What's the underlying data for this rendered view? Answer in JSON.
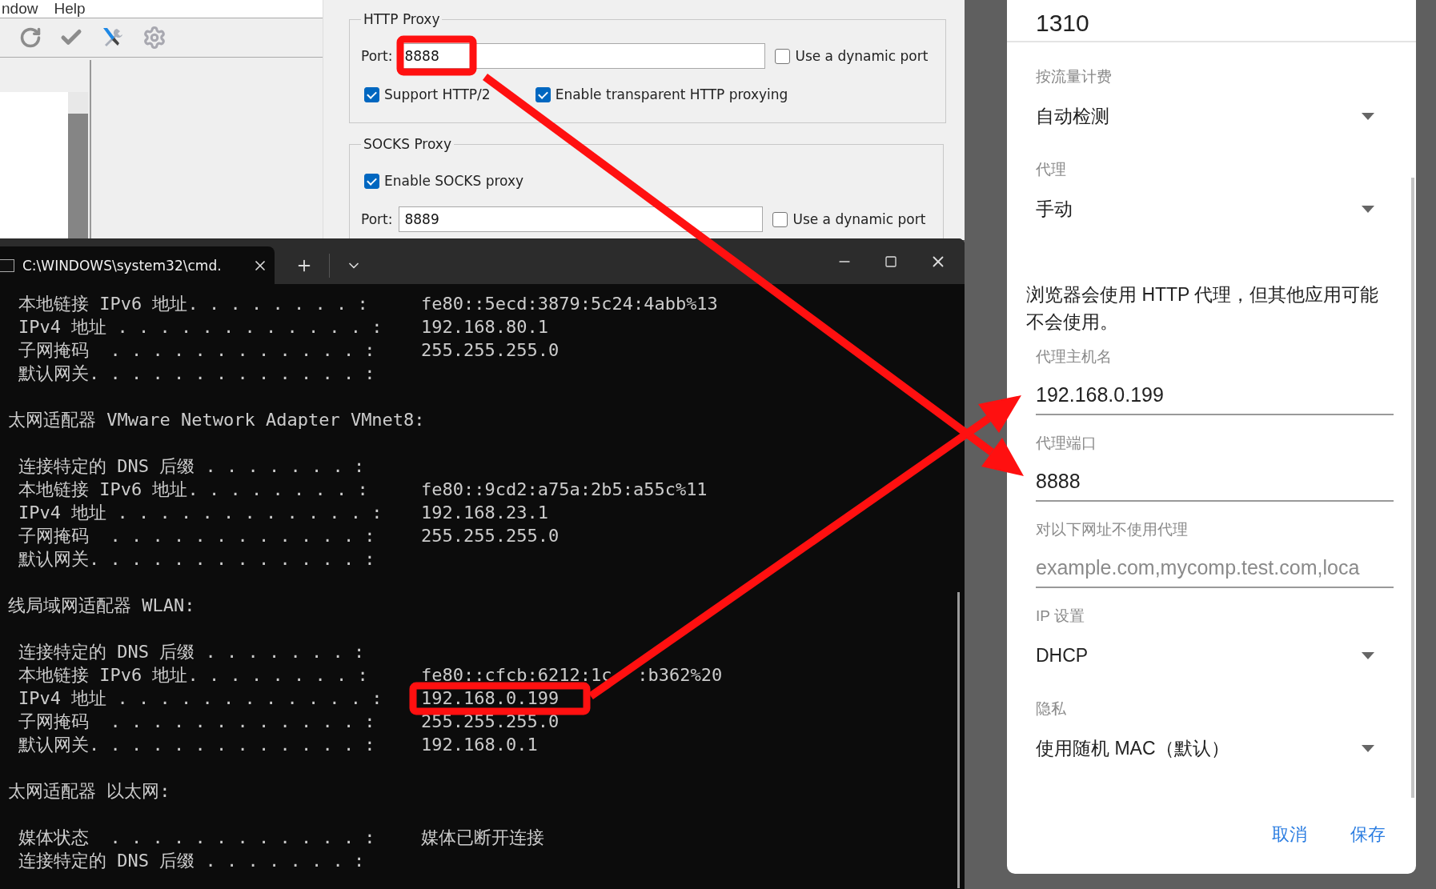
{
  "charles_window": {
    "menu": [
      "ndow",
      "Help"
    ]
  },
  "proxy_settings": {
    "http_proxy": {
      "title": "HTTP Proxy",
      "port_label": "Port:",
      "port": "8888",
      "dynamic_port": {
        "label": "Use a dynamic port",
        "checked": false
      },
      "options": [
        {
          "label": "Support HTTP/2",
          "checked": true
        },
        {
          "label": "Enable transparent HTTP proxying",
          "checked": true
        }
      ]
    },
    "socks_proxy": {
      "title": "SOCKS Proxy",
      "enable": {
        "label": "Enable SOCKS proxy",
        "checked": true
      },
      "port_label": "Port:",
      "port": "8889",
      "dynamic_port": {
        "label": "Use a dynamic port",
        "checked": false
      }
    }
  },
  "terminal": {
    "tab_title": "C:\\WINDOWS\\system32\\cmd.",
    "lines": [
      {
        "kind": "field",
        "label": "本地链接 IPv6 地址. . . . . . . . :",
        "value": "fe80::5ecd:3879:5c24:4abb%13"
      },
      {
        "kind": "field",
        "label": "IPv4 地址 . . . . . . . . . . . . :",
        "value": "192.168.80.1"
      },
      {
        "kind": "field",
        "label": "子网掩码  . . . . . . . . . . . . :",
        "value": "255.255.255.0"
      },
      {
        "kind": "field",
        "label": "默认网关. . . . . . . . . . . . . :"
      },
      {
        "kind": "blank"
      },
      {
        "kind": "heading",
        "text": "太网适配器 VMware Network Adapter VMnet8:"
      },
      {
        "kind": "blank"
      },
      {
        "kind": "field",
        "label": "连接特定的 DNS 后缀 . . . . . . . :"
      },
      {
        "kind": "field",
        "label": "本地链接 IPv6 地址. . . . . . . . :",
        "value": "fe80::9cd2:a75a:2b5:a55c%11"
      },
      {
        "kind": "field",
        "label": "IPv4 地址 . . . . . . . . . . . . :",
        "value": "192.168.23.1"
      },
      {
        "kind": "field",
        "label": "子网掩码  . . . . . . . . . . . . :",
        "value": "255.255.255.0"
      },
      {
        "kind": "field",
        "label": "默认网关. . . . . . . . . . . . . :"
      },
      {
        "kind": "blank"
      },
      {
        "kind": "heading",
        "text": "线局域网适配器 WLAN:"
      },
      {
        "kind": "blank"
      },
      {
        "kind": "field",
        "label": "连接特定的 DNS 后缀 . . . . . . . :"
      },
      {
        "kind": "split",
        "label": "本地链接 IPv6 地址. . . . . . . . :",
        "parts": [
          "fe80::cfcb:6212:1c",
          ":b362%20"
        ]
      },
      {
        "kind": "field",
        "label": "IPv4 地址 . . . . . . . . . . . . :",
        "value": "192.168.0.199"
      },
      {
        "kind": "field",
        "label": "子网掩码  . . . . . . . . . . . . :",
        "value": "255.255.255.0"
      },
      {
        "kind": "field",
        "label": "默认网关. . . . . . . . . . . . . :",
        "value": "192.168.0.1"
      },
      {
        "kind": "blank"
      },
      {
        "kind": "heading",
        "text": "太网适配器 以太网:"
      },
      {
        "kind": "blank"
      },
      {
        "kind": "field",
        "label": "媒体状态  . . . . . . . . . . . . :",
        "value": "媒体已断开连接"
      },
      {
        "kind": "field",
        "label": "连接特定的 DNS 后缀 . . . . . . . :"
      }
    ]
  },
  "wifi_dialog": {
    "top_value": "1310",
    "settings": [
      {
        "kind": "select",
        "label": "按流量计费",
        "value": "自动检测"
      },
      {
        "kind": "select",
        "label": "代理",
        "value": "手动"
      },
      {
        "kind": "note",
        "text": "浏览器会使用 HTTP 代理，但其他应用可能不会使用。"
      },
      {
        "kind": "input",
        "label": "代理主机名",
        "value": "192.168.0.199"
      },
      {
        "kind": "input",
        "label": "代理端口",
        "value": "8888"
      },
      {
        "kind": "input",
        "label": "对以下网址不使用代理",
        "placeholder": "example.com,mycomp.test.com,loca"
      },
      {
        "kind": "select",
        "label": "IP 设置",
        "value": "DHCP"
      },
      {
        "kind": "select",
        "label": "隐私",
        "value": "使用随机 MAC（默认）"
      }
    ],
    "buttons": [
      "取消",
      "保存"
    ]
  }
}
